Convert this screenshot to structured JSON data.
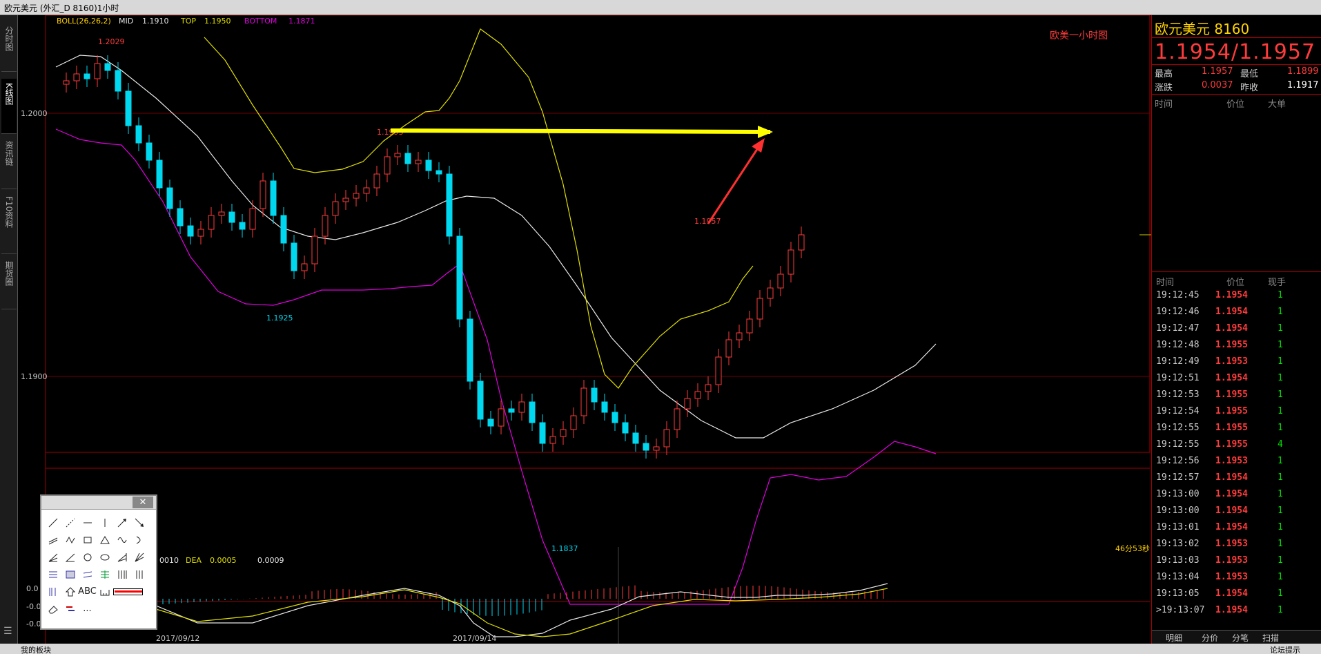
{
  "window": {
    "title": "欧元美元 (外汇_D 8160)1小时"
  },
  "left_tabs": [
    "分时图",
    "K线图",
    "资讯链",
    "F10资料",
    "期货圈"
  ],
  "bollinger": {
    "label": "BOLL(26,26,2)",
    "mid_label": "MID",
    "mid": "1.1910",
    "top_label": "TOP",
    "top": "1.1950",
    "bottom_label": "BOTTOM",
    "bottom": "1.1871"
  },
  "chart_label": "欧美一小时图",
  "price_labels": {
    "y_1_2000": "1.2000",
    "y_1_1900": "1.1900",
    "high_early": "1.2029",
    "peak_mid": "1.1993",
    "low_left": "1.1925",
    "low_mid": "1.1837",
    "latest_high": "1.1957"
  },
  "countdown": "46分53秒",
  "dates": [
    "2017/09/12",
    "2017/09/14"
  ],
  "macd": {
    "dif_label": "0010",
    "dea_label": "DEA",
    "dea": "0.0005",
    "macd": "0.0009",
    "axis": [
      "0.0",
      "-0.0",
      "-0.0"
    ]
  },
  "chart_data": {
    "type": "candlestick",
    "title": "欧美一小时图",
    "ylim": [
      1.1837,
      1.2029
    ],
    "annotations": [
      {
        "text": "1.2029",
        "kind": "high"
      },
      {
        "text": "1.1993",
        "kind": "swing-high"
      },
      {
        "text": "1.1925",
        "kind": "swing-low"
      },
      {
        "text": "1.1837",
        "kind": "low"
      },
      {
        "text": "1.1957",
        "kind": "latest-high"
      }
    ],
    "ticks_y": [
      "1.2000",
      "1.1900"
    ],
    "ticks_x": [
      "2017/09/12",
      "2017/09/14"
    ]
  },
  "quote": {
    "name": "欧元美元",
    "code": "8160",
    "price": "1.1954/1.1957",
    "high_label": "最高",
    "high": "1.1957",
    "low_label": "最低",
    "low": "1.1899",
    "change_label": "涨跌",
    "change": "0.0037",
    "prev_label": "昨收",
    "prev": "1.1917",
    "bigorder_headers": [
      "时间",
      "价位",
      "大单"
    ],
    "tick_headers": [
      "时间",
      "价位",
      "现手"
    ]
  },
  "ticks": [
    {
      "time": "19:12:45",
      "price": "1.1954",
      "vol": "1"
    },
    {
      "time": "19:12:46",
      "price": "1.1954",
      "vol": "1"
    },
    {
      "time": "19:12:47",
      "price": "1.1954",
      "vol": "1"
    },
    {
      "time": "19:12:48",
      "price": "1.1955",
      "vol": "1"
    },
    {
      "time": "19:12:49",
      "price": "1.1953",
      "vol": "1"
    },
    {
      "time": "19:12:51",
      "price": "1.1954",
      "vol": "1"
    },
    {
      "time": "19:12:53",
      "price": "1.1955",
      "vol": "1"
    },
    {
      "time": "19:12:54",
      "price": "1.1955",
      "vol": "1"
    },
    {
      "time": "19:12:55",
      "price": "1.1955",
      "vol": "1"
    },
    {
      "time": "19:12:55",
      "price": "1.1955",
      "vol": "4"
    },
    {
      "time": "19:12:56",
      "price": "1.1953",
      "vol": "1"
    },
    {
      "time": "19:12:57",
      "price": "1.1954",
      "vol": "1"
    },
    {
      "time": "19:13:00",
      "price": "1.1954",
      "vol": "1"
    },
    {
      "time": "19:13:00",
      "price": "1.1954",
      "vol": "1"
    },
    {
      "time": "19:13:01",
      "price": "1.1954",
      "vol": "1"
    },
    {
      "time": "19:13:02",
      "price": "1.1953",
      "vol": "1"
    },
    {
      "time": "19:13:03",
      "price": "1.1953",
      "vol": "1"
    },
    {
      "time": "19:13:04",
      "price": "1.1953",
      "vol": "1"
    },
    {
      "time": "19:13:05",
      "price": "1.1954",
      "vol": "1"
    },
    {
      "time": ">19:13:07",
      "price": "1.1954",
      "vol": "1"
    }
  ],
  "right_tabs": [
    "明细",
    "分价",
    "分笔",
    "扫描"
  ],
  "draw_tool": {
    "text_tool": "ABC",
    "more": "..."
  },
  "status": {
    "left": "我的板块",
    "right": "论坛提示"
  },
  "colors": {
    "candle_up": "#ff3b3b",
    "candle_down": "#00d8f0",
    "mid": "#e8e8e8",
    "top": "#e0e000",
    "bottom": "#e000e0",
    "arrow_yellow": "#ffff00",
    "arrow_red": "#ff3030"
  }
}
